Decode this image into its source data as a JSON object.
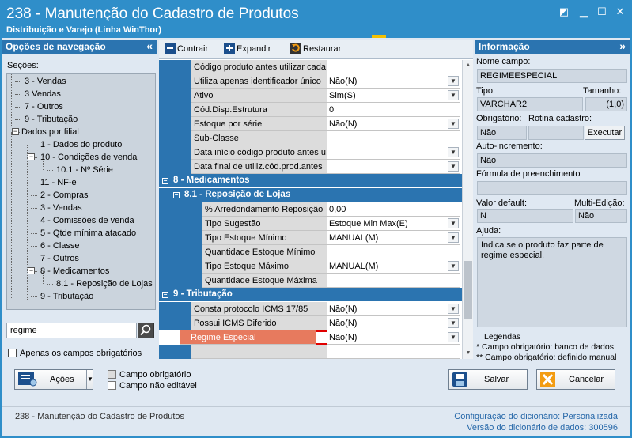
{
  "window": {
    "title": "238 - Manutenção do Cadastro de Produtos",
    "subtitle": "Distribuição e Varejo (Linha WinThor)"
  },
  "nav": {
    "header": "Opções de navegação",
    "sections_label": "Seções:",
    "items": [
      "3 - Vendas",
      "3 Vendas",
      "7 - Outros",
      "9 - Tributação",
      "Dados por filial",
      "1 - Dados do produto",
      "10 - Condições de venda",
      "10.1 - Nº Série",
      "11 - NF-e",
      "2 - Compras",
      "3 - Vendas",
      "4 - Comissões de venda",
      "5 - Qtde mínima atacado",
      "6 - Classe",
      "7 - Outros",
      "8 - Medicamentos",
      "8.1 - Reposição de Lojas",
      "9 - Tributação"
    ],
    "search_value": "regime",
    "only_required_label": "Apenas os campos obrigatórios"
  },
  "toolbar": {
    "collapse": "Contrair",
    "expand": "Expandir",
    "restore": "Restaurar"
  },
  "grid": {
    "rows_top": [
      {
        "label": "Código produto antes utilizar cada",
        "value": "",
        "dd": false
      },
      {
        "label": "Utiliza apenas identificador único",
        "value": "Não(N)",
        "dd": true
      },
      {
        "label": "Ativo",
        "value": "Sim(S)",
        "dd": true
      },
      {
        "label": "Cód.Disp.Estrutura",
        "value": "0",
        "dd": false
      },
      {
        "label": "Estoque por série",
        "value": "Não(N)",
        "dd": true
      },
      {
        "label": "Sub-Classe",
        "value": "",
        "dd": false
      },
      {
        "label": "Data início código produto antes u",
        "value": "",
        "dd": true
      },
      {
        "label": "Data final de utiliz.cód.prod.antes",
        "value": "",
        "dd": true
      }
    ],
    "cat8": "8 - Medicamentos",
    "cat81": "8.1 - Reposição de Lojas",
    "rows_81": [
      {
        "label": "% Arredondamento Reposição",
        "value": "0,00",
        "dd": false
      },
      {
        "label": "Tipo Sugestão",
        "value": "Estoque Min Max(E)",
        "dd": true
      },
      {
        "label": "Tipo Estoque Mínimo",
        "value": "MANUAL(M)",
        "dd": true
      },
      {
        "label": "Quantidade Estoque Mínimo",
        "value": "",
        "dd": false
      },
      {
        "label": "Tipo Estoque Máximo",
        "value": "MANUAL(M)",
        "dd": true
      },
      {
        "label": "Quantidade Estoque Máxima",
        "value": "",
        "dd": false
      }
    ],
    "cat9": "9 - Tributação",
    "rows_9": [
      {
        "label": "Consta protocolo ICMS 17/85",
        "value": "Não(N)",
        "dd": true
      },
      {
        "label": "Possui ICMS Diferido",
        "value": "Não(N)",
        "dd": true
      },
      {
        "label": "Regime Especial",
        "value": "Não(N)",
        "dd": true
      }
    ]
  },
  "info": {
    "header": "Informação",
    "field_name_label": "Nome campo:",
    "field_name": "REGIMEESPECIAL",
    "type_label": "Tipo:",
    "type": "VARCHAR2",
    "size_label": "Tamanho:",
    "size": "(1,0)",
    "required_label": "Obrigatório:",
    "required": "Não",
    "routine_label": "Rotina cadastro:",
    "execute_btn": "Executar",
    "autoinc_label": "Auto-incremento:",
    "autoinc": "Não",
    "formula_label": "Fórmula de preenchimento",
    "formula": "",
    "default_label": "Valor default:",
    "default": "N",
    "multi_label": "Multi-Edição:",
    "multi": "Não",
    "help_label": "Ajuda:",
    "help": "Indica se o produto faz parte de regime especial.",
    "legend_title": "Legendas",
    "legend1": "* Campo obrigatório: banco de dados",
    "legend2": "** Campo obrigatório: definido manual"
  },
  "bottom": {
    "actions": "Ações",
    "legend_required": "Campo obrigatório",
    "legend_readonly": "Campo não editável",
    "save": "Salvar",
    "cancel": "Cancelar"
  },
  "status": {
    "left": "238 - Manutenção do Cadastro de Produtos",
    "config_label": "Configuração do dicionário:",
    "config_value": "Personalizada",
    "version_label": "Versão do dicionário de dados:",
    "version_value": "300596"
  },
  "colors": {
    "title_bar": "#2f8ec9",
    "panel_header": "#2b74b0",
    "highlight": "#e77a5e",
    "highlight_border": "#e00000"
  }
}
